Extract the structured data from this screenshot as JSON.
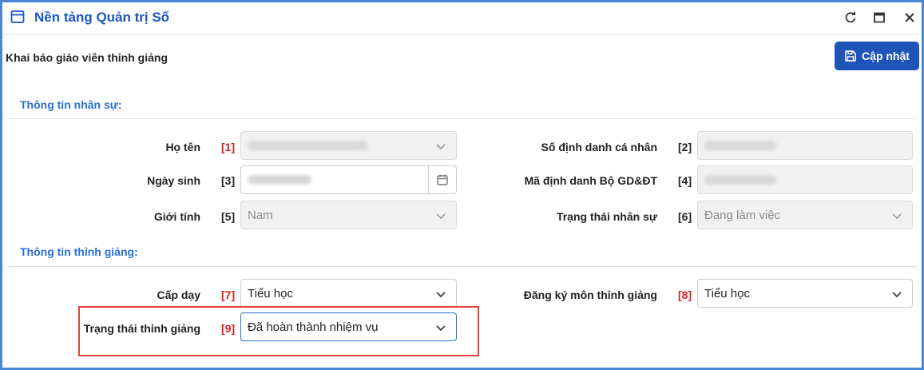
{
  "window": {
    "title": "Nền tảng Quản trị Số"
  },
  "page": {
    "title": "Khai báo giáo viên thỉnh giảng",
    "update_label": "Cập nhật"
  },
  "groups": {
    "personal": "Thông tin nhân sự:",
    "visiting": "Thông tin thỉnh giảng:"
  },
  "fields": {
    "ho_ten": {
      "label": "Họ tên",
      "num": "[1]"
    },
    "so_dinh_danh": {
      "label": "Số định danh cá nhân",
      "num": "[2]"
    },
    "ngay_sinh": {
      "label": "Ngày sinh",
      "num": "[3]"
    },
    "ma_dinh_danh": {
      "label": "Mã định danh Bộ GD&ĐT",
      "num": "[4]"
    },
    "gioi_tinh": {
      "label": "Giới tính",
      "num": "[5]",
      "value": "Nam"
    },
    "trang_thai_nhan_su": {
      "label": "Trạng thái nhân sự",
      "num": "[6]",
      "value": "Đang làm việc"
    },
    "cap_day": {
      "label": "Cấp dạy",
      "num": "[7]",
      "value": "Tiểu học"
    },
    "dang_ky_mon": {
      "label": "Đăng ký môn thỉnh giảng",
      "num": "[8]",
      "value": "Tiểu học"
    },
    "trang_thai_thinh_giang": {
      "label": "Trạng thái thỉnh giảng",
      "num": "[9]",
      "value": "Đã hoàn thành nhiệm vụ"
    }
  },
  "colors": {
    "accent": "#1e54b7",
    "title": "#1a56c4",
    "group": "#2a6fd6",
    "required": "#d81f1f",
    "highlight": "#e0443a"
  }
}
